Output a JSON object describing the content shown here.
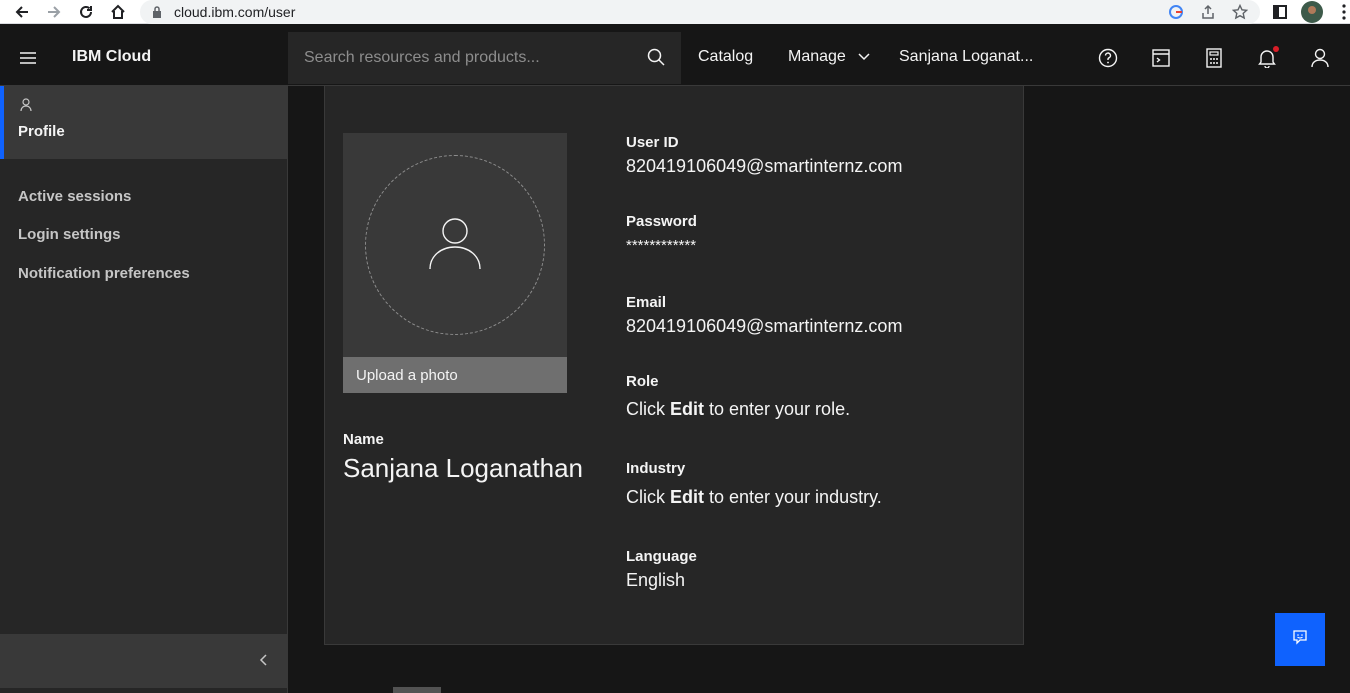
{
  "browser": {
    "url": "cloud.ibm.com/user"
  },
  "header": {
    "brand": "IBM Cloud",
    "search_placeholder": "Search resources and products...",
    "catalog": "Catalog",
    "manage": "Manage",
    "account": "Sanjana Loganat..."
  },
  "sidebar": {
    "active": "Profile",
    "items": [
      "Active sessions",
      "Login settings",
      "Notification preferences"
    ]
  },
  "profile": {
    "upload_label": "Upload a photo",
    "name_label": "Name",
    "name_value": "Sanjana Loganathan",
    "user_id_label": "User ID",
    "user_id_value": "820419106049@smartinternz.com",
    "password_label": "Password",
    "password_value": "************",
    "email_label": "Email",
    "email_value": "820419106049@smartinternz.com",
    "role_label": "Role",
    "role_prefix": "Click ",
    "edit_word": "Edit",
    "role_suffix": " to enter your role.",
    "industry_label": "Industry",
    "industry_prefix": "Click ",
    "industry_suffix": " to enter your industry.",
    "language_label": "Language",
    "language_value": "English"
  },
  "colors": {
    "accent": "#0f62fe",
    "notification": "#da1e28"
  }
}
